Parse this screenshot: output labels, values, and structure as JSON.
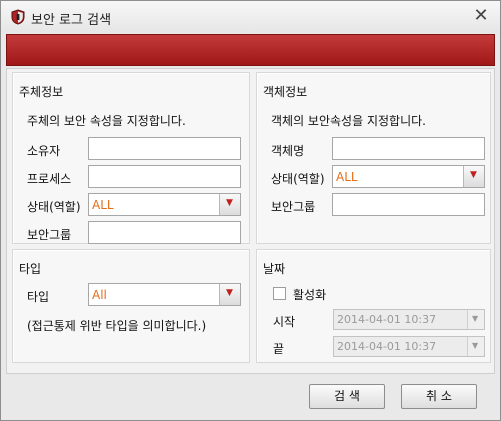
{
  "window": {
    "title": "보안 로그 검색",
    "close_symbol": "✕"
  },
  "subject_panel": {
    "title": "주체정보",
    "description": "주체의 보안 속성을 지정합니다.",
    "owner_label": "소유자",
    "process_label": "프로세스",
    "state_label": "상태(역할)",
    "state_value": "ALL",
    "group_label": "보안그룹"
  },
  "object_panel": {
    "title": "객체정보",
    "description": "객체의 보안속성을 지정합니다.",
    "name_label": "객체명",
    "state_label": "상태(역할)",
    "state_value": "ALL",
    "group_label": "보안그룹"
  },
  "type_panel": {
    "title": "타입",
    "type_label": "타입",
    "type_value": "All",
    "note": "(접근통제 위반 타입을 의미합니다.)"
  },
  "date_panel": {
    "title": "날짜",
    "activate_label": "활성화",
    "activate_checked": false,
    "start_label": "시작",
    "start_value": "2014-04-01 10:37",
    "end_label": "끝",
    "end_value": "2014-04-01 10:37"
  },
  "buttons": {
    "search": "검 색",
    "cancel": "취 소"
  },
  "colors": {
    "accent_red": "#b02020",
    "value_orange": "#e46e1a"
  },
  "icons": {
    "title": "shield-icon",
    "close": "close-icon",
    "dropdown": "dropdown-arrow-icon"
  }
}
